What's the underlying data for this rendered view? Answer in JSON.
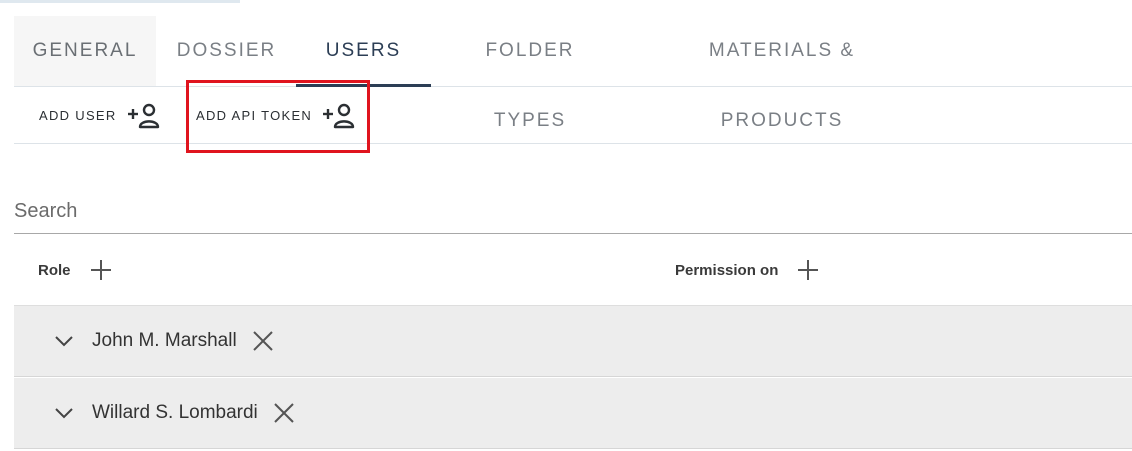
{
  "tabs": [
    {
      "label": "GENERAL"
    },
    {
      "label": "DOSSIER"
    },
    {
      "label": "USERS",
      "active": true
    },
    {
      "label": "FOLDER TYPES"
    },
    {
      "label": "MATERIALS & PRODUCTS"
    }
  ],
  "toolbar": {
    "add_user_label": "ADD USER",
    "add_api_token_label": "ADD API TOKEN",
    "icon": "person-add-icon"
  },
  "search": {
    "placeholder": "Search",
    "value": ""
  },
  "table": {
    "columns": [
      {
        "label": "Role"
      },
      {
        "label": "Permission on"
      }
    ],
    "rows": [
      {
        "name": "John M. Marshall"
      },
      {
        "name": "Willard S. Lombardi"
      }
    ]
  },
  "colors": {
    "active_tab": "#2c3e55",
    "highlight_box": "#e0141e",
    "row_background": "#ededed"
  }
}
